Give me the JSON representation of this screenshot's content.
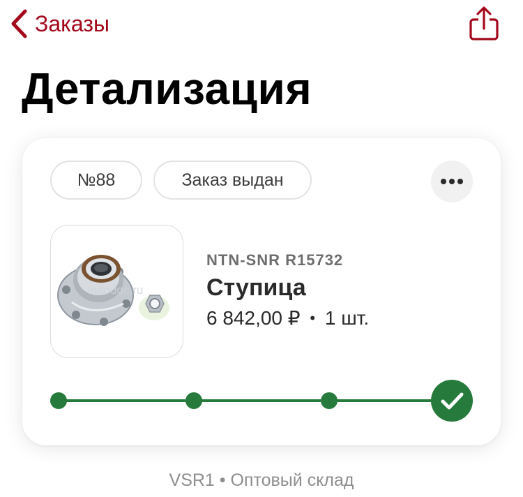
{
  "nav": {
    "back_label": "Заказы",
    "back_icon": "chevron-left-icon",
    "share_icon": "share-icon"
  },
  "page": {
    "title": "Детализация"
  },
  "order": {
    "number_label": "№88",
    "status_label": "Заказ выдан",
    "more_icon": "ellipsis-icon"
  },
  "product": {
    "code": "NTN-SNR R15732",
    "name": "Ступица",
    "price": "6 842,00 ₽",
    "separator": "•",
    "quantity": "1 шт.",
    "image_watermark": "autodoc.ru"
  },
  "progress": {
    "steps_total": 4,
    "steps_completed": 4
  },
  "footer": {
    "text": "VSR1 • Оптовый склад"
  },
  "colors": {
    "accent": "#a3091b",
    "progress_green": "#267a3c",
    "muted_text": "#8e8e8e"
  }
}
